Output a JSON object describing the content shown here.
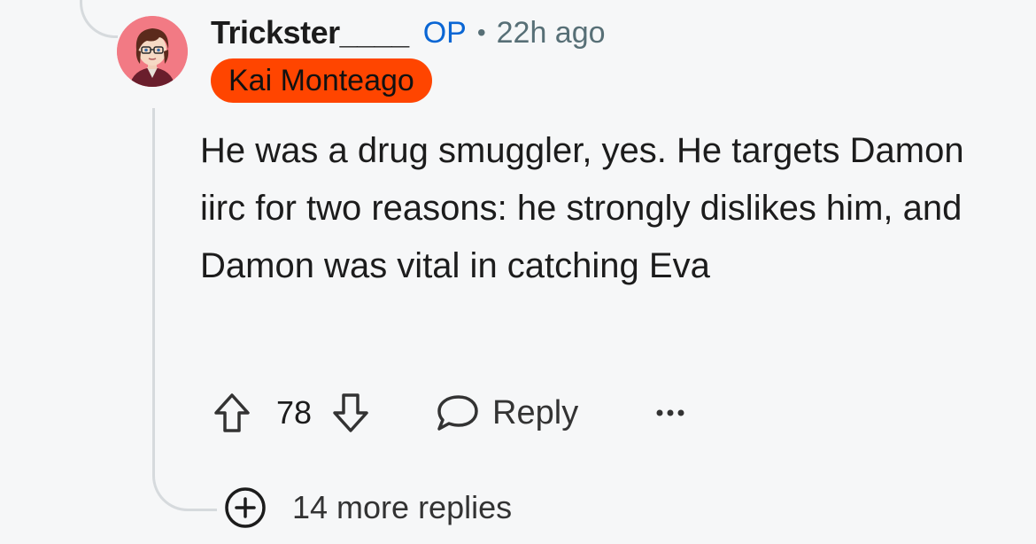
{
  "comment": {
    "username": "Trickster____",
    "op_badge": "OP",
    "separator": "•",
    "timestamp": "22h ago",
    "flair": "Kai Monteago",
    "body": "He was a drug smuggler, yes. He targets Damon iirc for two reasons: he strongly dislikes him, and Damon was vital in catching Eva",
    "score": "78",
    "reply_label": "Reply",
    "more_replies_label": "14 more replies"
  },
  "icons": {
    "upvote": "upvote-arrow-icon",
    "downvote": "downvote-arrow-icon",
    "reply": "speech-bubble-icon",
    "more": "ellipsis-icon",
    "expand": "plus-circle-icon"
  },
  "colors": {
    "background": "#f6f7f8",
    "op_blue": "#0a66d4",
    "flair_bg": "#ff4500",
    "meta_gray": "#576f76",
    "thread_line": "#d6dadd",
    "avatar_bg": "#f27a84"
  }
}
